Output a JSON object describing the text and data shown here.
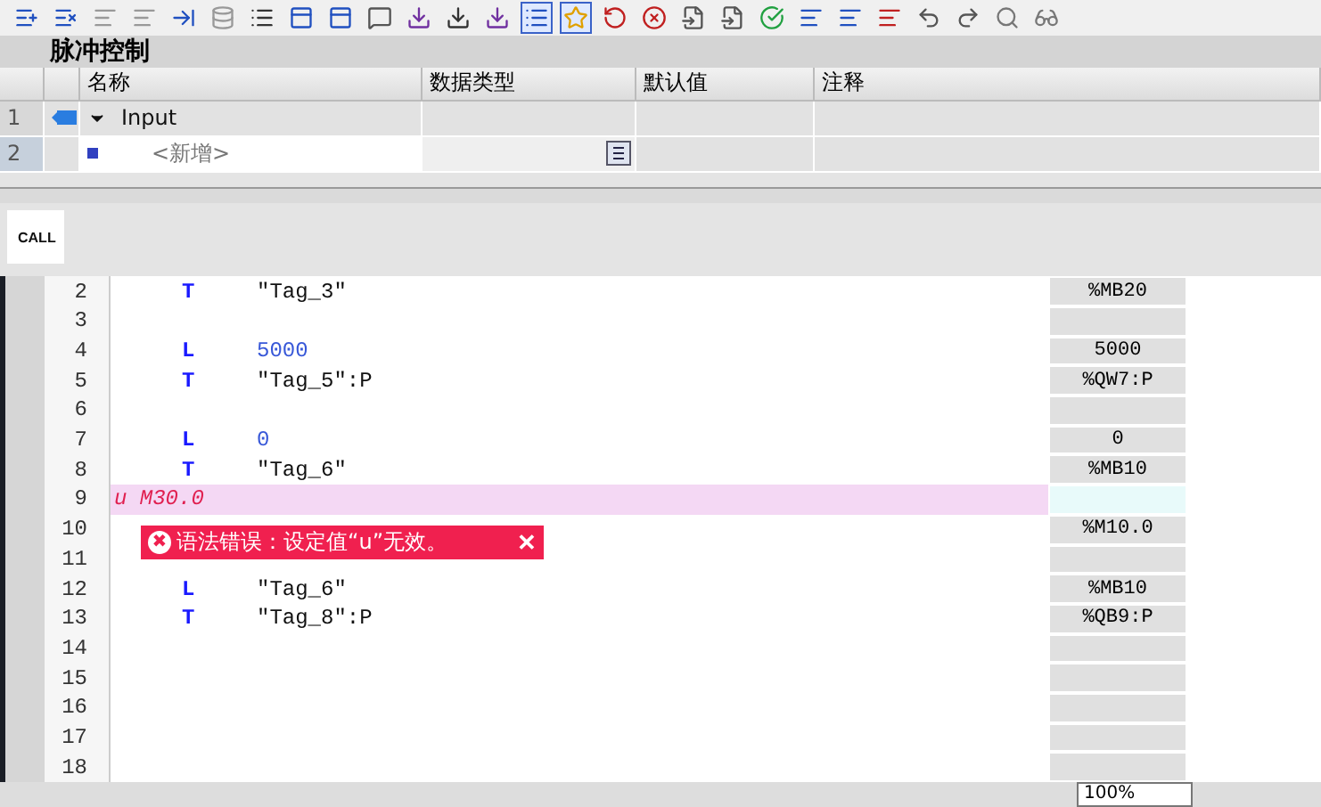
{
  "block_title": "脉冲控制",
  "interface_table": {
    "columns": [
      "名称",
      "数据类型",
      "默认值",
      "注释"
    ],
    "rows": [
      {
        "number": "1",
        "kind": "section",
        "name": "Input",
        "expanded": true,
        "selected": false
      },
      {
        "number": "2",
        "kind": "new",
        "name": "<新增>",
        "selected": true
      }
    ]
  },
  "instruction_tab": {
    "label": "CALL"
  },
  "code_lines": [
    {
      "number": "2",
      "kind": "code",
      "op": "T",
      "operand": "\"Tag_3\"",
      "constant": false,
      "address": "%MB20"
    },
    {
      "number": "3",
      "kind": "blank"
    },
    {
      "number": "4",
      "kind": "code",
      "op": "L",
      "operand": "5000",
      "constant": true,
      "address": "5000"
    },
    {
      "number": "5",
      "kind": "code",
      "op": "T",
      "operand": "\"Tag_5\":P",
      "constant": false,
      "address": "%QW7:P"
    },
    {
      "number": "6",
      "kind": "blank"
    },
    {
      "number": "7",
      "kind": "code",
      "op": "L",
      "operand": "0",
      "constant": true,
      "address": "0"
    },
    {
      "number": "8",
      "kind": "code",
      "op": "T",
      "operand": "\"Tag_6\"",
      "constant": false,
      "address": "%MB10"
    },
    {
      "number": "9",
      "kind": "error",
      "text": "u M30.0"
    },
    {
      "number": "10",
      "kind": "blank",
      "address": "%M10.0"
    },
    {
      "number": "11",
      "kind": "blank"
    },
    {
      "number": "12",
      "kind": "code",
      "op": "L",
      "operand": "\"Tag_6\"",
      "constant": false,
      "address": "%MB10"
    },
    {
      "number": "13",
      "kind": "code",
      "op": "T",
      "operand": "\"Tag_8\":P",
      "constant": false,
      "address": "%QB9:P"
    },
    {
      "number": "14",
      "kind": "blank"
    },
    {
      "number": "15",
      "kind": "blank"
    },
    {
      "number": "16",
      "kind": "blank"
    },
    {
      "number": "17",
      "kind": "blank"
    },
    {
      "number": "18",
      "kind": "blank"
    }
  ],
  "error_popup": {
    "icon": "✖",
    "message": "语法错误：设定值“u”无效。",
    "close": "✕"
  },
  "zoom": {
    "value": "100%"
  }
}
